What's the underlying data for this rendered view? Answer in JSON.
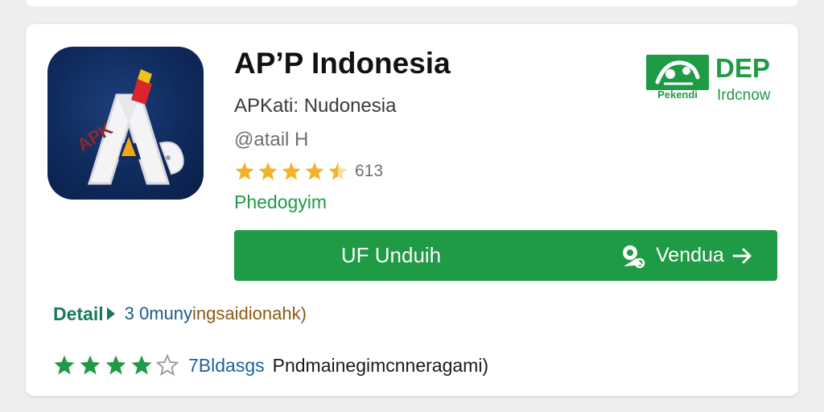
{
  "app": {
    "title": "AP’P Indonesia",
    "subtitle": "APKati: Nudonesia",
    "handle": "@atail H",
    "rating_value": 4.5,
    "rating_count": "613",
    "category": "Phedogyim",
    "icon_text": "APK",
    "icon": "app-logo-letter-a"
  },
  "brand": {
    "name": "DEP",
    "caption_left": "Pekendi",
    "caption_right": "Irdcnow"
  },
  "download": {
    "label": "UF Unduih",
    "secondary_label": "Vendua",
    "secondary_icon": "gear-pin-icon",
    "arrow_icon": "arrow-right-icon"
  },
  "details": {
    "label": "Detail",
    "text_a": "3 0muny",
    "text_b": "ingsaidionahk)"
  },
  "bottom": {
    "stars_filled": 4,
    "stars_total": 5,
    "label": "7Bldasgs",
    "text": "Pndmainegimcnneragami)"
  },
  "colors": {
    "brand_green": "#1f9a45",
    "star_gold": "#f2b32a",
    "icon_navy": "#0f2a5c"
  }
}
